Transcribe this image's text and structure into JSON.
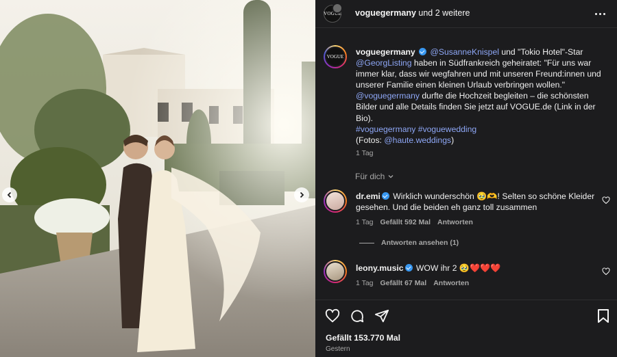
{
  "post": {
    "header_account": "voguegermany",
    "header_suffix": "und 2 weitere",
    "avatar_text": "VOGUE",
    "photo_alt": "Brautpaar im Garten",
    "caption": {
      "account": "voguegermany",
      "mention1": "@SusanneKnispel",
      "text1": " und \"Tokio Hotel\"-Star ",
      "mention2": "@GeorgListing",
      "text2": " haben in Südfrankreich geheiratet: \"Für uns war immer klar, dass wir wegfahren und mit unseren Freund:innen und unserer Familie einen kleinen Urlaub verbringen wollen.\"",
      "mention3": "@voguegermany",
      "text3": " durfte die Hochzeit begleiten – die schönsten Bilder und alle Details finden Sie jetzt auf VOGUE.de (Link in der Bio).",
      "hashtags": "#voguegermany #voguewedding",
      "credit_prefix": "(Fotos: ",
      "credit_mention": "@haute.weddings",
      "credit_suffix": ")",
      "time": "1 Tag"
    },
    "for_you_label": "Für dich",
    "comments": [
      {
        "user": "dr.emi",
        "text": " Wirklich wunderschön 🥹🫶! Selten so schöne Kleider gesehen. Und die beiden eh ganz toll zusammen",
        "time": "1 Tag",
        "likes": "Gefällt 592 Mal",
        "reply": "Antworten"
      },
      {
        "user": "leony.music",
        "text": " WOW ihr 2 🥹❤️❤️❤️",
        "time": "1 Tag",
        "likes": "Gefällt 67 Mal",
        "reply": "Antworten"
      }
    ],
    "view_replies": "Antworten ansehen (1)",
    "total_likes": "Gefällt 153.770 Mal",
    "posted": "Gestern"
  },
  "icons": {
    "more": "more-horizontal-icon",
    "heart": "heart-icon",
    "comment": "comment-icon",
    "share": "share-icon",
    "bookmark": "bookmark-icon",
    "verified": "verified-badge-icon",
    "prev": "chevron-left-icon",
    "next": "chevron-right-icon"
  },
  "colors": {
    "panel_bg": "#1c1c1e",
    "link": "#8ea7f6",
    "verified": "#3897f0",
    "muted": "#a8a8a8"
  }
}
